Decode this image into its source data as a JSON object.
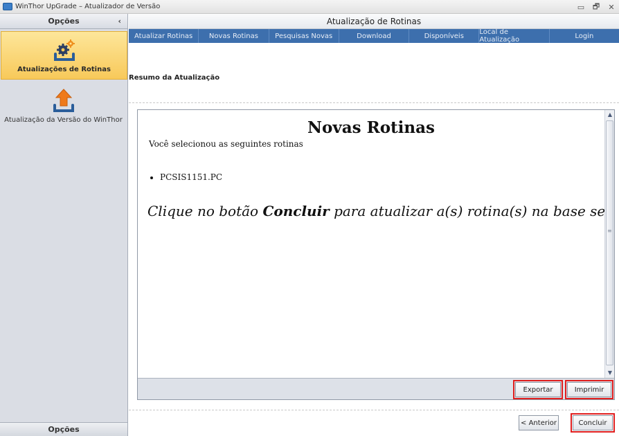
{
  "window": {
    "title": "WinThor UpGrade – Atualizador de Versão",
    "controls": [
      "▭",
      "🗗",
      "✕"
    ]
  },
  "sidebar": {
    "header": "Opções",
    "collapse_glyph": "‹",
    "items": [
      {
        "label": "Atualizações de Rotinas",
        "icon": "gears-update-icon",
        "active": true
      },
      {
        "label": "Atualização da Versão do WinThor",
        "icon": "upload-arrow-icon",
        "active": false
      }
    ],
    "footer": "Opções"
  },
  "main": {
    "title": "Atualização de Rotinas",
    "tabs": [
      "Atualizar Rotinas",
      "Novas Rotinas",
      "Pesquisas Novas",
      "Download",
      "Disponíveis",
      "Local de Atualização",
      "Login"
    ],
    "summary_title": "Resumo da Atualização",
    "document": {
      "heading": "Novas Rotinas",
      "subtitle": "Você selecionou as seguintes rotinas",
      "routines": [
        "PCSIS1151.PC"
      ],
      "message_before": "Clique no botão ",
      "message_bold": "Concluir",
      "message_after": " para atualizar a(s) rotina(s) na base selecionada"
    },
    "panel_buttons": {
      "export": "Exportar",
      "print": "Imprimir"
    },
    "nav_buttons": {
      "previous": "< Anterior",
      "finish": "Concluir"
    }
  },
  "colors": {
    "tab_bar": "#3d6fad",
    "active_item": "#f8c95a",
    "highlight_outline": "#e01e1e",
    "sidebar_bg": "#dadde4"
  }
}
